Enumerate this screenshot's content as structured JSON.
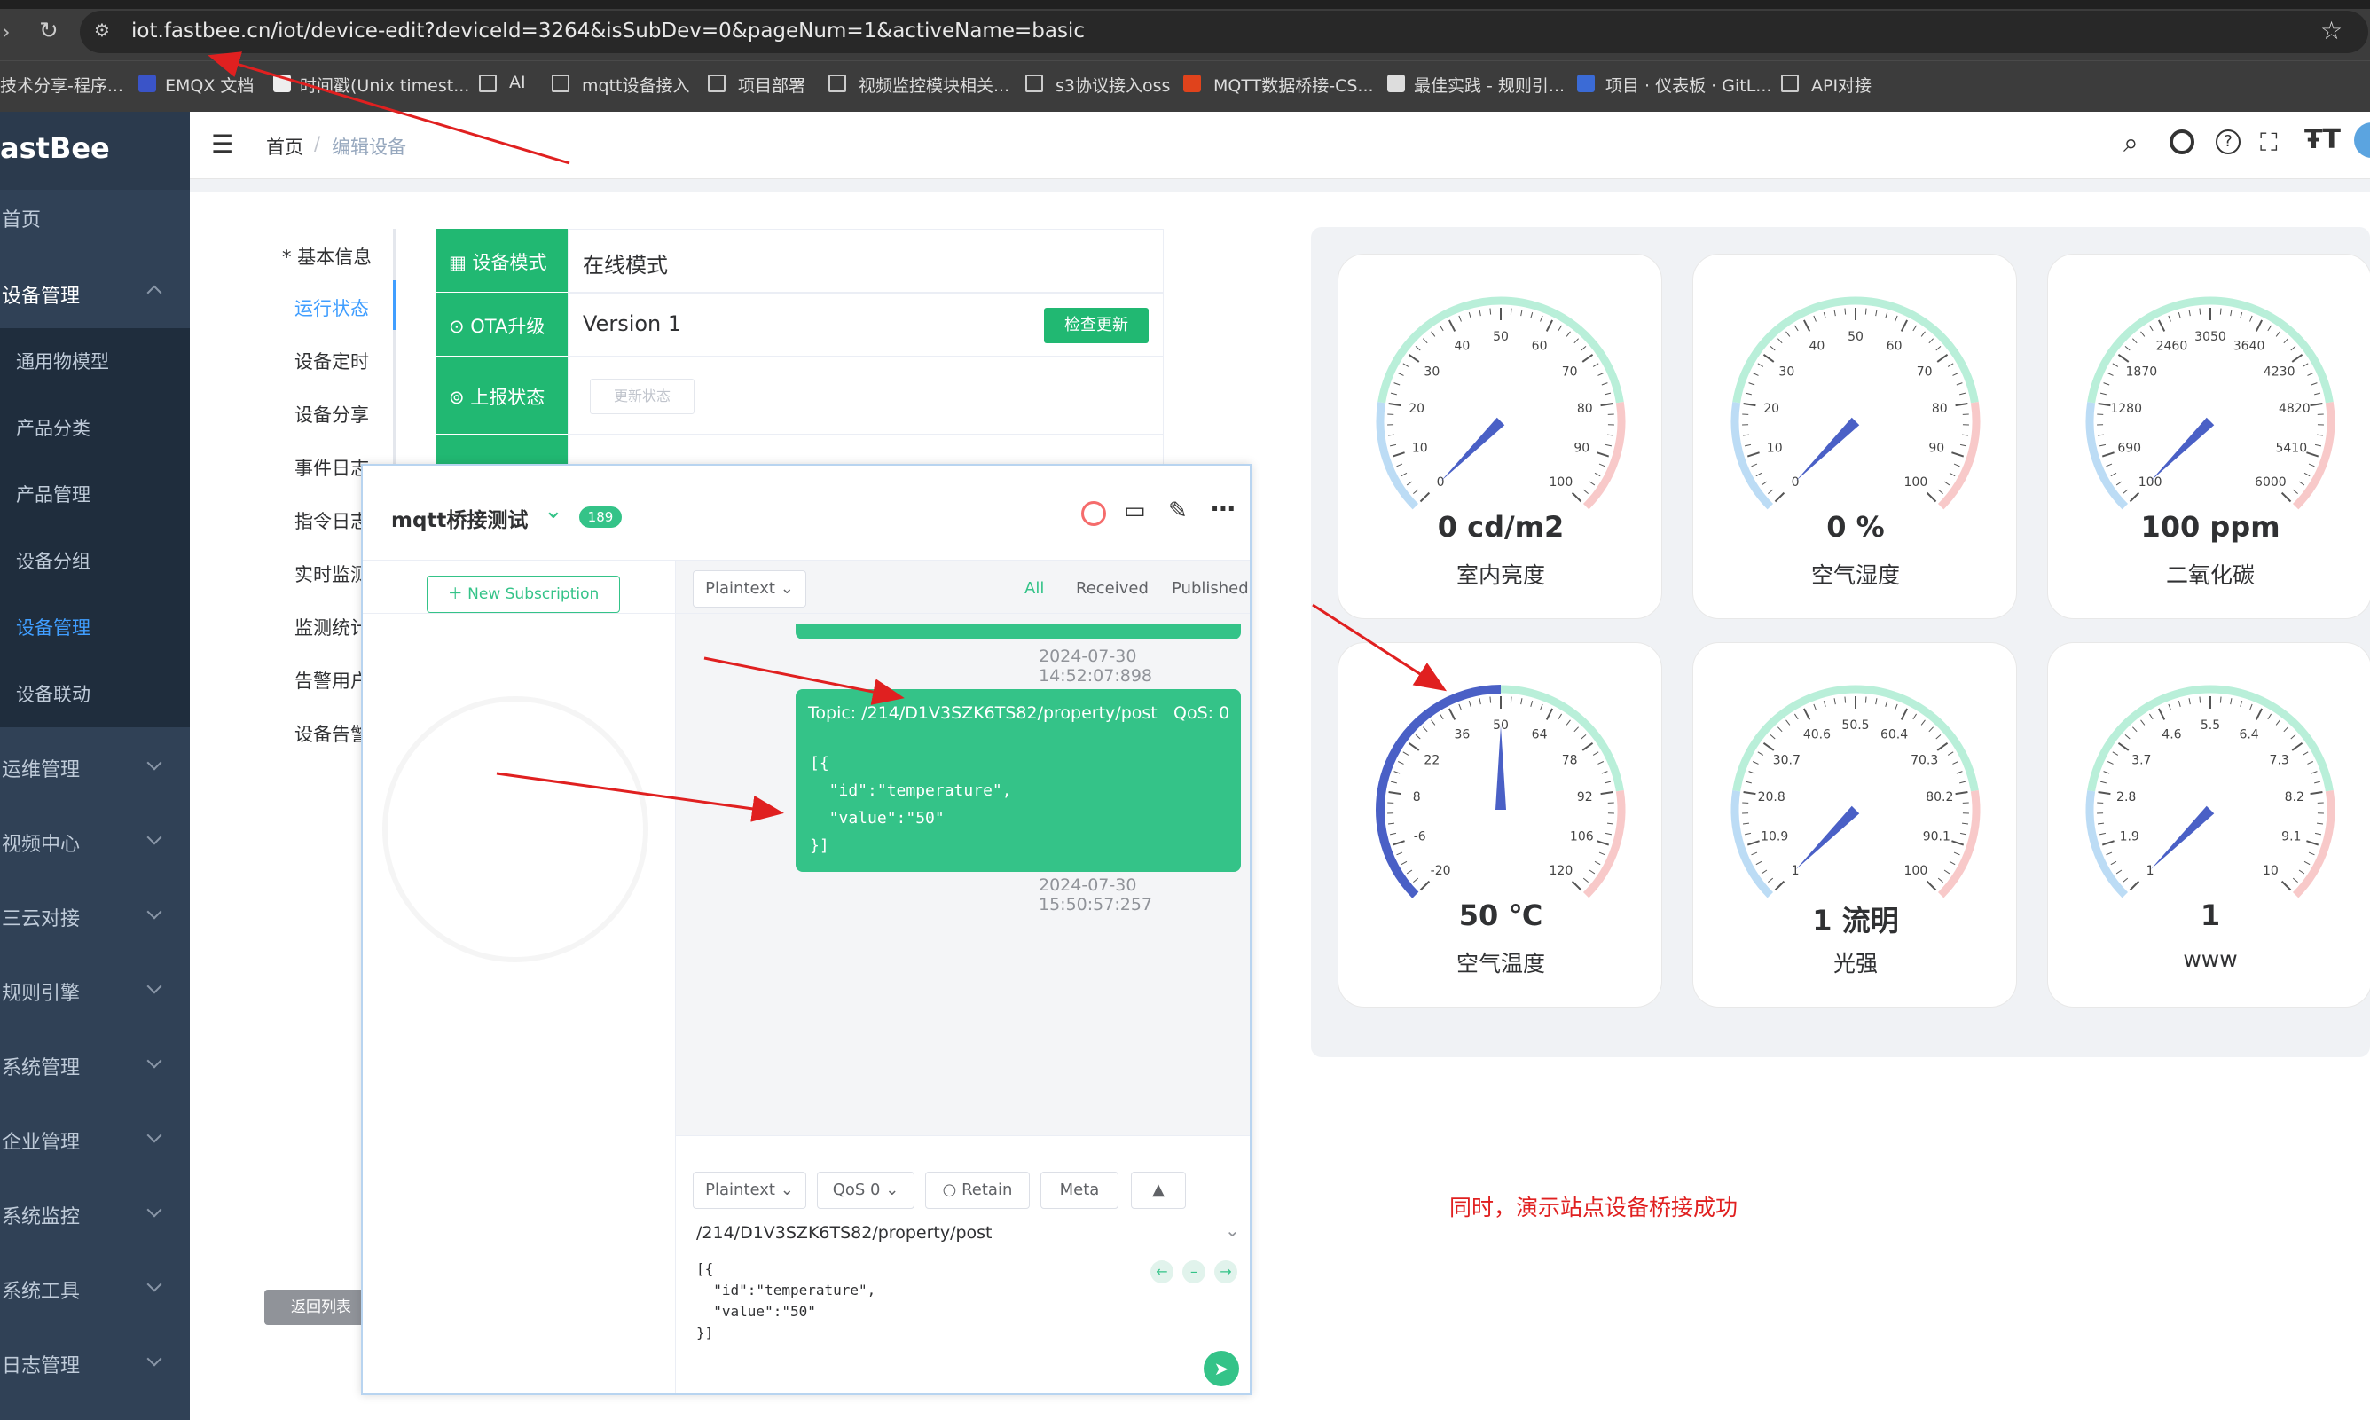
{
  "browser": {
    "url": "iot.fastbee.cn/iot/device-edit?deviceId=3264&isSubDev=0&pageNum=1&activeName=basic",
    "bookmarks": [
      "技术分享-程序...",
      "EMQX 文档",
      "时间戳(Unix timest...",
      "AI",
      "mqtt设备接入",
      "项目部署",
      "视频监控模块相关...",
      "s3协议接入oss",
      "MQTT数据桥接-CS...",
      "最佳实践 - 规则引...",
      "项目 · 仪表板 · GitL...",
      "API对接"
    ]
  },
  "sidebar": {
    "logo": "astBee",
    "items": [
      {
        "label": "首页"
      },
      {
        "label": "设备管理"
      },
      {
        "label": "通用物模型"
      },
      {
        "label": "产品分类"
      },
      {
        "label": "产品管理"
      },
      {
        "label": "设备分组"
      },
      {
        "label": "设备管理"
      },
      {
        "label": "设备联动"
      },
      {
        "label": "运维管理"
      },
      {
        "label": "视频中心"
      },
      {
        "label": "三云对接"
      },
      {
        "label": "规则引擎"
      },
      {
        "label": "系统管理"
      },
      {
        "label": "企业管理"
      },
      {
        "label": "系统监控"
      },
      {
        "label": "系统工具"
      },
      {
        "label": "日志管理"
      }
    ]
  },
  "header": {
    "breadcrumb_home": "首页",
    "breadcrumb_sep": "/",
    "breadcrumb_current": "编辑设备"
  },
  "tabs": {
    "basic": "* 基本信息",
    "running": "运行状态",
    "timer": "设备定时",
    "share": "设备分享",
    "event": "事件日志",
    "command": "指令日志",
    "realtime": "实时监测",
    "stats": "监测统计",
    "alert_user": "告警用户",
    "alert": "设备告警",
    "back": "返回列表"
  },
  "status": {
    "mode_label": "设备模式",
    "mode_value": "在线模式",
    "ota_label": "OTA升级",
    "ota_value": "Version 1",
    "ota_button": "检查更新",
    "report_label": "上报状态",
    "report_button": "更新状态"
  },
  "gauges": [
    {
      "value_text": "0 cd/m2",
      "name": "室内亮度",
      "ticks": [
        "0",
        "10",
        "20",
        "30",
        "40",
        "50",
        "60",
        "70",
        "80",
        "90",
        "100"
      ],
      "fraction": 0.0
    },
    {
      "value_text": "0 %",
      "name": "空气湿度",
      "ticks": [
        "0",
        "10",
        "20",
        "30",
        "40",
        "50",
        "60",
        "70",
        "80",
        "90",
        "100"
      ],
      "fraction": 0.0
    },
    {
      "value_text": "100 ppm",
      "name": "二氧化碳",
      "ticks": [
        "100",
        "690",
        "1280",
        "1870",
        "2460",
        "3050",
        "3640",
        "4230",
        "4820",
        "5410",
        "6000"
      ],
      "fraction": 0.0
    },
    {
      "value_text": "50 ℃",
      "name": "空气温度",
      "ticks": [
        "-20",
        "-6",
        "8",
        "22",
        "36",
        "50",
        "64",
        "78",
        "92",
        "106",
        "120"
      ],
      "fraction": 0.5
    },
    {
      "value_text": "1 流明",
      "name": "光强",
      "ticks": [
        "1",
        "10.9",
        "20.8",
        "30.7",
        "40.6",
        "50.5",
        "60.4",
        "70.3",
        "80.2",
        "90.1",
        "100"
      ],
      "fraction": 0.0
    },
    {
      "value_text": "1",
      "name": "www",
      "ticks": [
        "1",
        "1.9",
        "2.8",
        "3.7",
        "4.6",
        "5.5",
        "6.4",
        "7.3",
        "8.2",
        "9.1",
        "10"
      ],
      "fraction": 0.0
    }
  ],
  "mqttx": {
    "title": "mqtt桥接测试",
    "badge": "189",
    "new_sub": "New Subscription",
    "format": "Plaintext",
    "filter_all": "All",
    "filter_received": "Received",
    "filter_published": "Published",
    "time1": "2024-07-30 14:52:07:898",
    "topic": "Topic: /214/D1V3SZK6TS82/property/post",
    "qos": "QoS: 0",
    "payload": [
      "[{",
      "  \"id\":\"temperature\",",
      "  \"value\":\"50\"",
      "}]"
    ],
    "time2": "2024-07-30 15:50:57:257",
    "pub_format": "Plaintext",
    "pub_qos": "QoS 0",
    "retain": "Retain",
    "meta": "Meta",
    "pub_topic": "/214/D1V3SZK6TS82/property/post",
    "pub_payload": [
      "[{",
      "  \"id\":\"temperature\",",
      "  \"value\":\"50\"",
      "}]"
    ]
  },
  "annotation": "同时，演示站点设备桥接成功",
  "colors": {
    "sidebar": "#304156",
    "accent_green": "#21b872",
    "message_green": "#34c388",
    "active_blue": "#409eff",
    "annotation_red": "#e02020"
  }
}
